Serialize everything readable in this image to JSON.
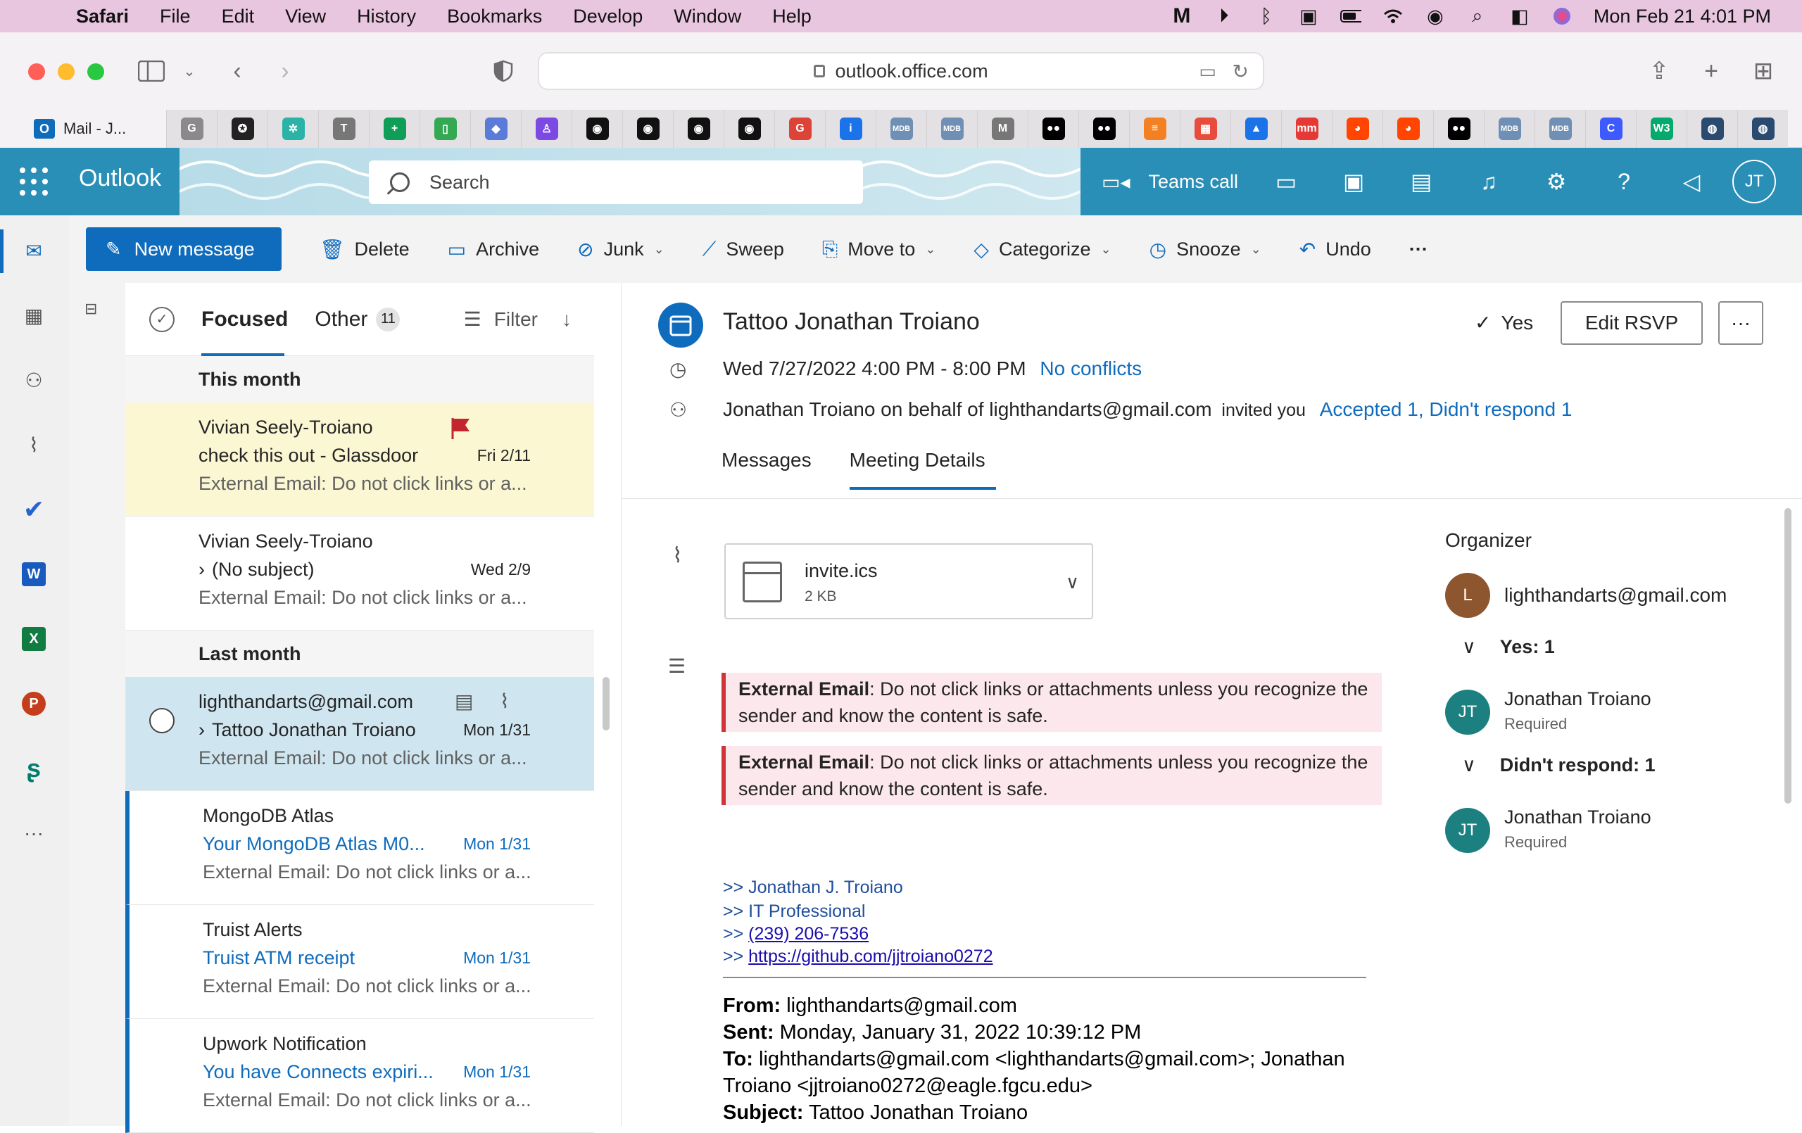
{
  "menubar": {
    "app": "Safari",
    "items": [
      "File",
      "Edit",
      "View",
      "History",
      "Bookmarks",
      "Develop",
      "Window",
      "Help"
    ],
    "clock": "Mon Feb 21  4:01 PM"
  },
  "safari": {
    "url": "outlook.office.com",
    "active_tab": "Mail - J...",
    "favicons": [
      {
        "label": "G",
        "color": "#8a8a8a"
      },
      {
        "label": "✪",
        "color": "#222"
      },
      {
        "label": "✲",
        "color": "#2ab3a6"
      },
      {
        "label": "T",
        "color": "#777"
      },
      {
        "label": "+",
        "color": "#0f9d58"
      },
      {
        "label": "▯",
        "color": "#34a853"
      },
      {
        "label": "◆",
        "color": "#5a7bd8"
      },
      {
        "label": "♙",
        "color": "#7b4ae2"
      },
      {
        "label": "◉",
        "color": "#111"
      },
      {
        "label": "◉",
        "color": "#111"
      },
      {
        "label": "◉",
        "color": "#111"
      },
      {
        "label": "◉",
        "color": "#111"
      },
      {
        "label": "G",
        "color": "#db4437"
      },
      {
        "label": "i",
        "color": "#1a73e8"
      },
      {
        "label": "MDB",
        "color": "#6f8fb5"
      },
      {
        "label": "MDB",
        "color": "#6f8fb5"
      },
      {
        "label": "M",
        "color": "#777"
      },
      {
        "label": "●●",
        "color": "#000"
      },
      {
        "label": "●●",
        "color": "#000"
      },
      {
        "label": "≡",
        "color": "#f48024"
      },
      {
        "label": "▦",
        "color": "#e74c3c"
      },
      {
        "label": "▲",
        "color": "#1a73e8"
      },
      {
        "label": "mm",
        "color": "#e53935"
      },
      {
        "label": "◕",
        "color": "#ff4500"
      },
      {
        "label": "◕",
        "color": "#ff4500"
      },
      {
        "label": "●●",
        "color": "#000"
      },
      {
        "label": "MDB",
        "color": "#6f8fb5"
      },
      {
        "label": "MDB",
        "color": "#6f8fb5"
      },
      {
        "label": "C",
        "color": "#3d5afe"
      },
      {
        "label": "W3",
        "color": "#04aa6d"
      },
      {
        "label": "◍",
        "color": "#2b4a6f"
      },
      {
        "label": "◍",
        "color": "#2b4a6f"
      }
    ]
  },
  "outlook": {
    "brand": "Outlook",
    "search_placeholder": "Search",
    "teams_call": "Teams call",
    "user_initials": "JT",
    "commands": {
      "new_message": "New message",
      "delete": "Delete",
      "archive": "Archive",
      "junk": "Junk",
      "sweep": "Sweep",
      "move_to": "Move to",
      "categorize": "Categorize",
      "snooze": "Snooze",
      "undo": "Undo",
      "more": "···"
    },
    "list": {
      "focused": "Focused",
      "other": "Other",
      "other_count": "11",
      "filter": "Filter",
      "sections": {
        "this_month": "This month",
        "last_month": "Last month"
      },
      "items": [
        {
          "sender": "Vivian Seely-Troiano",
          "subject": "check this out - Glassdoor",
          "date": "Fri 2/11",
          "preview": "External Email: Do not click links or a..."
        },
        {
          "sender": "Vivian Seely-Troiano",
          "subject": "(No subject)",
          "date": "Wed 2/9",
          "preview": "External Email: Do not click links or a..."
        },
        {
          "sender": "lighthandarts@gmail.com",
          "subject": "Tattoo Jonathan Troiano",
          "date": "Mon 1/31",
          "preview": "External Email: Do not click links or a..."
        },
        {
          "sender": "MongoDB Atlas",
          "subject": "Your MongoDB Atlas M0...",
          "date": "Mon 1/31",
          "preview": "External Email: Do not click links or a..."
        },
        {
          "sender": "Truist Alerts",
          "subject": "Truist ATM receipt",
          "date": "Mon 1/31",
          "preview": "External Email: Do not click links or a..."
        },
        {
          "sender": "Upwork Notification",
          "subject": "You have Connects expiri...",
          "date": "Mon 1/31",
          "preview": "External Email: Do not click links or a..."
        }
      ]
    },
    "reading": {
      "subject": "Tattoo Jonathan Troiano",
      "rsvp_status": "Yes",
      "edit_rsvp": "Edit RSVP",
      "more": "···",
      "when": "Wed 7/27/2022 4:00 PM - 8:00 PM",
      "conflicts": "No conflicts",
      "invited_by": "Jonathan Troiano on behalf of lighthandarts@gmail.com",
      "invited_you": "invited you",
      "responses": "Accepted 1, Didn't respond 1",
      "tabs": [
        "Messages",
        "Meeting Details"
      ],
      "attachment": {
        "name": "invite.ics",
        "size": "2 KB"
      },
      "warning": {
        "bold": "External Email",
        "text": ": Do not click links or attachments unless you recognize the sender and know the content is safe."
      },
      "signature": {
        "line1": ">> Jonathan J. Troiano",
        "line2": ">> IT Professional",
        "prefix": ">> ",
        "phone": "(239) 206-7536",
        "url": "https://github.com/jjtroiano0272"
      },
      "headers": {
        "from_label": "From:",
        "from": "lighthandarts@gmail.com",
        "sent_label": "Sent:",
        "sent": "Monday, January 31, 2022 10:39:12 PM",
        "to_label": "To:",
        "to": "lighthandarts@gmail.com <lighthandarts@gmail.com>; Jonathan Troiano <jjtroiano0272@eagle.fgcu.edu>",
        "subject_label": "Subject:",
        "subject": "Tattoo Jonathan Troiano"
      },
      "side": {
        "organizer_label": "Organizer",
        "organizer_initial": "L",
        "organizer": "lighthandarts@gmail.com",
        "yes_group": "Yes: 1",
        "yes_person": "Jonathan Troiano",
        "yes_role": "Required",
        "noresp_group": "Didn't respond: 1",
        "noresp_person": "Jonathan Troiano",
        "noresp_role": "Required",
        "person_initials": "JT"
      }
    }
  },
  "colors": {
    "accent": "#0f6cbd",
    "header_teal": "#2a8fb6",
    "selected_row": "#cfe6f0",
    "flagged_row": "#fbf7d3",
    "flag_red": "#c4262e"
  }
}
